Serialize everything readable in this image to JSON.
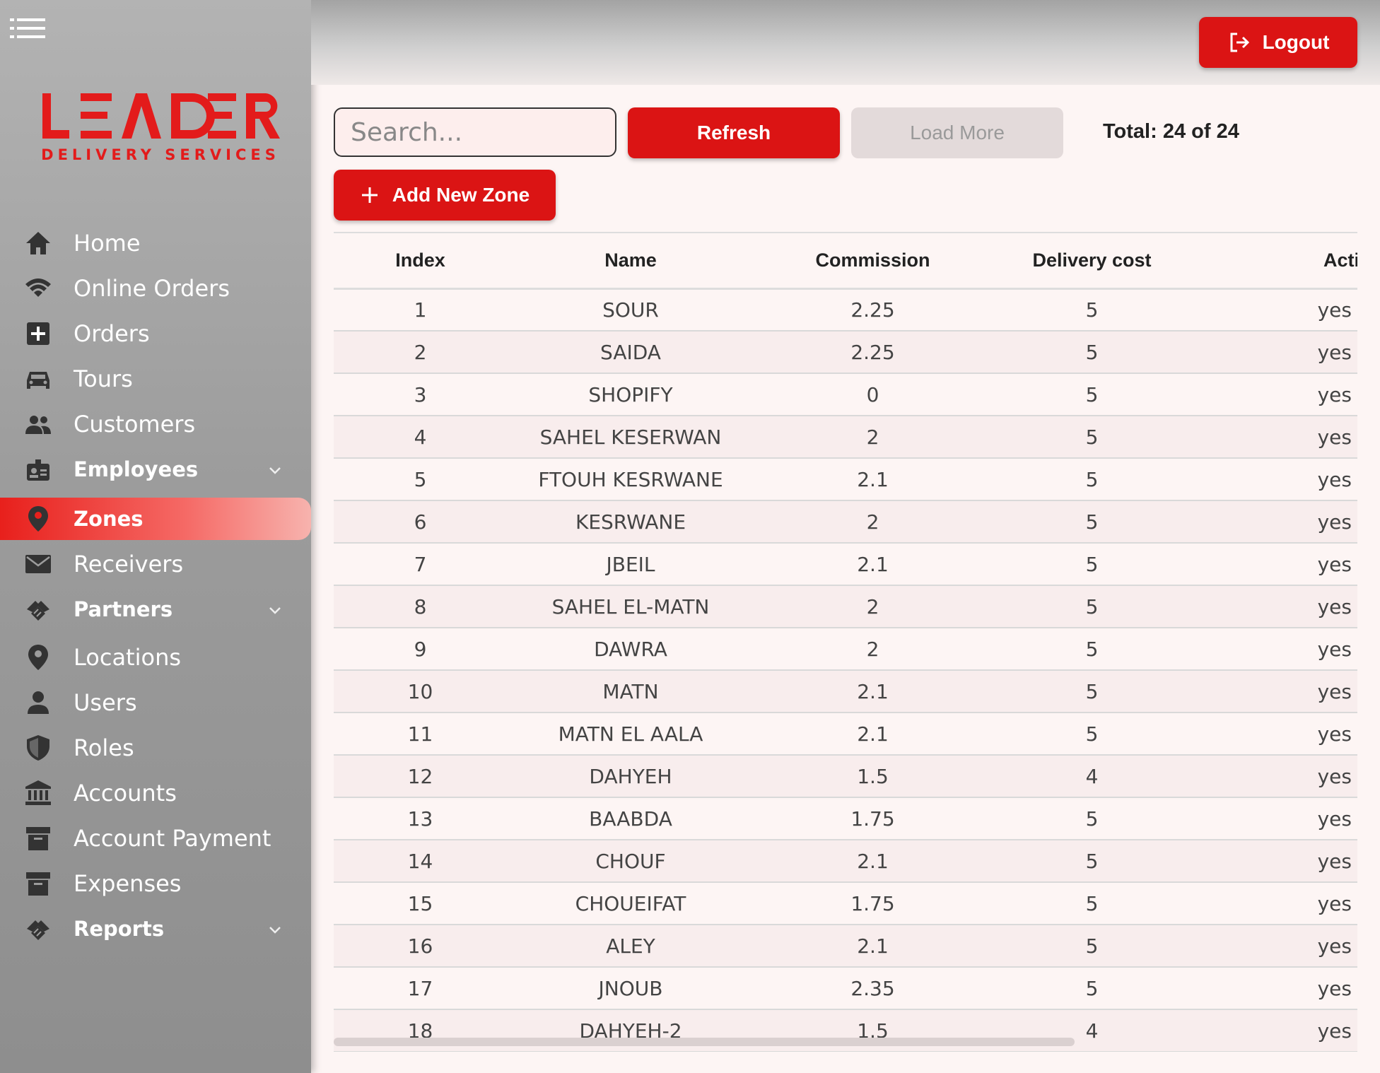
{
  "brand": {
    "name": "LEADER",
    "tagline": "DELIVERY SERVICES",
    "accent": "#db1414"
  },
  "sidebar": {
    "items": [
      {
        "label": "Home",
        "icon": "home-icon"
      },
      {
        "label": "Online Orders",
        "icon": "wifi-icon"
      },
      {
        "label": "Orders",
        "icon": "plus-box-icon"
      },
      {
        "label": "Tours",
        "icon": "car-icon"
      },
      {
        "label": "Customers",
        "icon": "people-icon"
      },
      {
        "label": "Employees",
        "icon": "badge-icon",
        "expandable": true
      },
      {
        "label": "Zones",
        "icon": "location-pin-icon",
        "active": true
      },
      {
        "label": "Receivers",
        "icon": "mail-icon"
      },
      {
        "label": "Partners",
        "icon": "handshake-icon",
        "expandable": true
      },
      {
        "label": "Locations",
        "icon": "location-pin-icon"
      },
      {
        "label": "Users",
        "icon": "person-icon"
      },
      {
        "label": "Roles",
        "icon": "shield-icon"
      },
      {
        "label": "Accounts",
        "icon": "bank-icon"
      },
      {
        "label": "Account Payment",
        "icon": "archive-icon"
      },
      {
        "label": "Expenses",
        "icon": "archive-icon"
      },
      {
        "label": "Reports",
        "icon": "handshake-icon",
        "expandable": true
      }
    ]
  },
  "topbar": {
    "logout_label": "Logout"
  },
  "toolbar": {
    "search_placeholder": "Search...",
    "refresh_label": "Refresh",
    "load_more_label": "Load More",
    "total_text": "Total: 24 of 24",
    "add_label": "Add New Zone"
  },
  "table": {
    "columns": [
      "Index",
      "Name",
      "Commission",
      "Delivery cost",
      "Active"
    ],
    "rows": [
      [
        "1",
        "SOUR",
        "2.25",
        "5",
        "yes"
      ],
      [
        "2",
        "SAIDA",
        "2.25",
        "5",
        "yes"
      ],
      [
        "3",
        "SHOPIFY",
        "0",
        "5",
        "yes"
      ],
      [
        "4",
        "SAHEL KESERWAN",
        "2",
        "5",
        "yes"
      ],
      [
        "5",
        "FTOUH KESRWANE",
        "2.1",
        "5",
        "yes"
      ],
      [
        "6",
        "KESRWANE",
        "2",
        "5",
        "yes"
      ],
      [
        "7",
        "JBEIL",
        "2.1",
        "5",
        "yes"
      ],
      [
        "8",
        "SAHEL EL-MATN",
        "2",
        "5",
        "yes"
      ],
      [
        "9",
        "DAWRA",
        "2",
        "5",
        "yes"
      ],
      [
        "10",
        "MATN",
        "2.1",
        "5",
        "yes"
      ],
      [
        "11",
        "MATN EL AALA",
        "2.1",
        "5",
        "yes"
      ],
      [
        "12",
        "DAHYEH",
        "1.5",
        "4",
        "yes"
      ],
      [
        "13",
        "BAABDA",
        "1.75",
        "5",
        "yes"
      ],
      [
        "14",
        "CHOUF",
        "2.1",
        "5",
        "yes"
      ],
      [
        "15",
        "CHOUEIFAT",
        "1.75",
        "5",
        "yes"
      ],
      [
        "16",
        "ALEY",
        "2.1",
        "5",
        "yes"
      ],
      [
        "17",
        "JNOUB",
        "2.35",
        "5",
        "yes"
      ],
      [
        "18",
        "DAHYEH-2",
        "1.5",
        "4",
        "yes"
      ]
    ]
  }
}
